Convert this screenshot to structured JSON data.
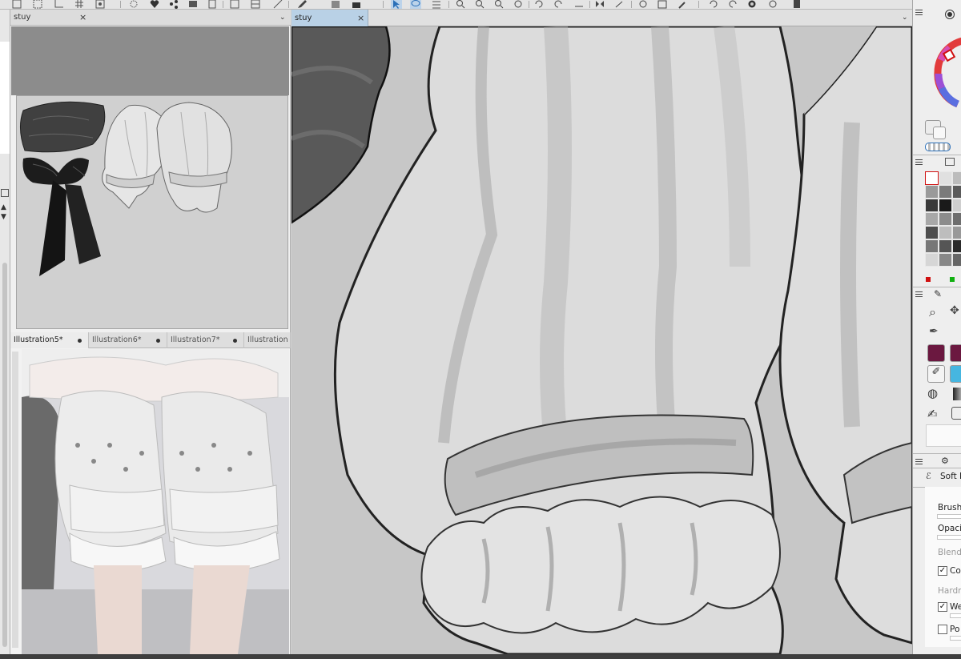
{
  "sub_view": {
    "tab_label": "stuy",
    "close_glyph": "×",
    "dropdown_glyph": "⌄"
  },
  "main_canvas": {
    "tab_label": "stuy",
    "close_glyph": "×",
    "dropdown_glyph": "⌄"
  },
  "reference_tabs": [
    {
      "label": "Illustration5*",
      "active": true
    },
    {
      "label": "Illustration6*",
      "active": false
    },
    {
      "label": "Illustration7*",
      "active": false
    },
    {
      "label": "Illustration",
      "active": false
    }
  ],
  "tool_property": {
    "tool_name": "Soft P",
    "rows": [
      {
        "label": "Brush",
        "enabled": true
      },
      {
        "label": "Opaci",
        "enabled": true
      },
      {
        "label": "Blend",
        "enabled": false
      },
      {
        "label": "Co",
        "enabled": true,
        "checked": true
      },
      {
        "label": "Hardn",
        "enabled": false
      },
      {
        "label": "We",
        "enabled": true,
        "checked": true
      },
      {
        "label": "Po",
        "enabled": true,
        "checked": false
      }
    ]
  },
  "check_glyph": "✓",
  "colors": {
    "accent_tab": "#b9d1e6",
    "color_set": [
      "#ffffff",
      "#e0e0e0",
      "#bcbcbc",
      "#9a9a9a",
      "#7a7a7a",
      "#5a5a5a",
      "#3a3a3a",
      "#1a1a1a",
      "#cfcfcf",
      "#a8a8a8",
      "#8c8c8c",
      "#6e6e6e",
      "#4e4e4e",
      "#bdbdbd",
      "#999999",
      "#777777",
      "#555555",
      "#2a2a2a",
      "#d6d6d6",
      "#888888",
      "#666666"
    ],
    "marker_red": "#d01010",
    "marker_green": "#10b010"
  },
  "icons": [
    "selection-icon",
    "lasso-icon",
    "pen-icon",
    "zoom-in-icon",
    "zoom-out-icon",
    "rotate-icon",
    "flip-icon",
    "undo-icon",
    "redo-icon",
    "eyedropper-icon",
    "move-icon",
    "bucket-icon",
    "brush-icon",
    "gradient-icon"
  ]
}
